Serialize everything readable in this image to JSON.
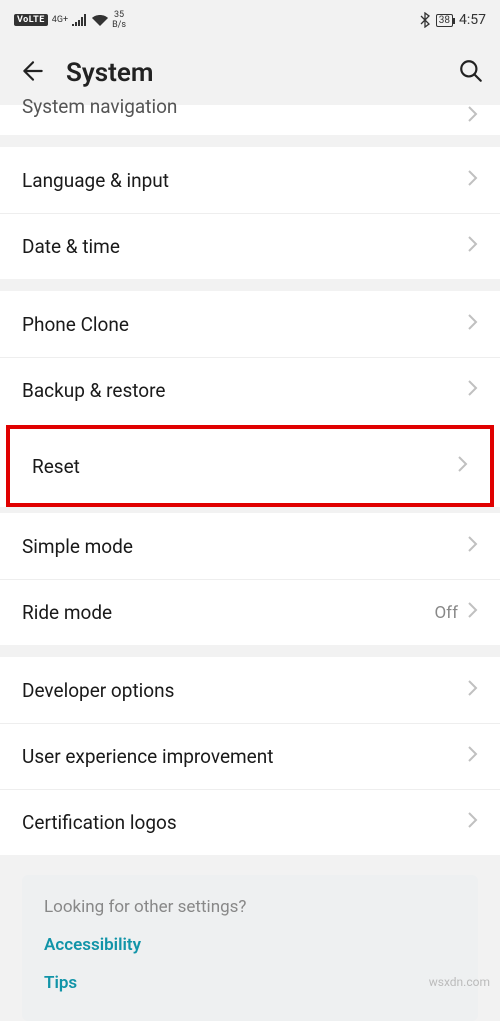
{
  "status": {
    "volte": "VoLTE",
    "net_gen": "4G+",
    "speed_value": "35",
    "speed_unit": "B/s",
    "battery": "38",
    "time": "4:57"
  },
  "header": {
    "title": "System"
  },
  "rows": {
    "system_navigation": "System navigation",
    "language_input": "Language & input",
    "date_time": "Date & time",
    "phone_clone": "Phone Clone",
    "backup_restore": "Backup & restore",
    "reset": "Reset",
    "simple_mode": "Simple mode",
    "ride_mode": "Ride mode",
    "ride_mode_value": "Off",
    "developer_options": "Developer options",
    "user_experience": "User experience improvement",
    "certification_logos": "Certification logos"
  },
  "info": {
    "heading": "Looking for other settings?",
    "link1": "Accessibility",
    "link2": "Tips"
  },
  "watermark": "wsxdn.com"
}
